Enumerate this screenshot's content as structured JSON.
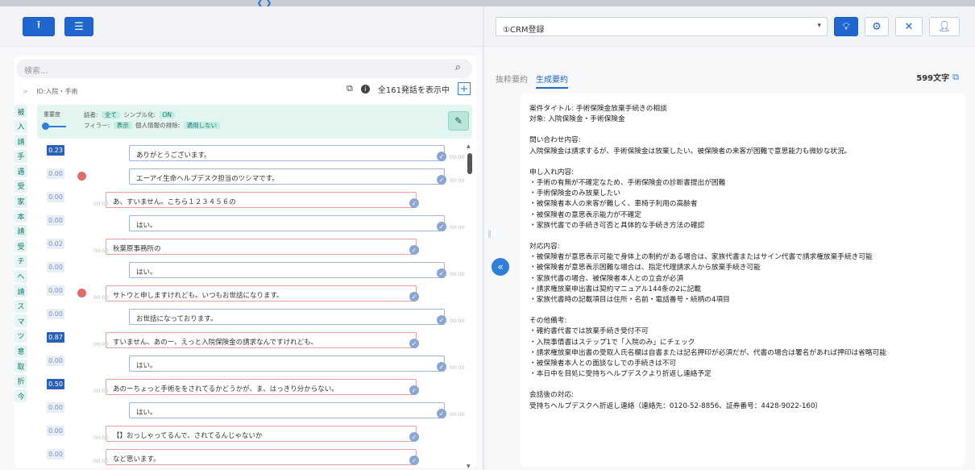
{
  "toolbar_left": {
    "upload_icon": "upload-icon",
    "list_icon": "list-icon"
  },
  "toolbar_right": {
    "select_value": "①CRM登録",
    "icons": [
      "bulb-icon",
      "gear-icon",
      "close-icon",
      "user-icon"
    ]
  },
  "search": {
    "placeholder": "検索..."
  },
  "transcript": {
    "breadcrumb": "ID:入院・手術",
    "count_text": "全161発話を表示中",
    "category_tags": [
      "被",
      "入",
      "請",
      "手",
      "遇",
      "受",
      "家",
      "本",
      "請",
      "受",
      "チ",
      "へ",
      "請",
      "ス",
      "マ",
      "ツ",
      "意",
      "取",
      "折",
      "今"
    ],
    "filter": {
      "importance_label": "重要度",
      "speaker_label": "話者:",
      "speaker_value": "全て",
      "simple_label": "シンプル化:",
      "simple_value": "ON",
      "filler_label": "フィラー:",
      "filler_value": "表示",
      "pii_label": "個人情報の排除:",
      "pii_value": "適用しない"
    },
    "rows": [
      {
        "score": "0.23",
        "speaker": "op",
        "text": "ありがとうございます。",
        "time": "00:00",
        "hot": true
      },
      {
        "score": "0.00",
        "speaker": "op",
        "text": "エーアイ生命ヘルプデスク担当のツシマです。",
        "time": "00:00",
        "avatar": true
      },
      {
        "score": "0.00",
        "speaker": "cu",
        "text": "あ、すいません。こちら１２３４５６の",
        "time": "00:00"
      },
      {
        "score": "0.00",
        "speaker": "op",
        "text": "はい。",
        "time": "00:00"
      },
      {
        "score": "0.02",
        "speaker": "cu",
        "text": "秋葉原事務所の",
        "time": "00:00"
      },
      {
        "score": "0.00",
        "speaker": "op",
        "text": "はい。",
        "time": "00:00"
      },
      {
        "score": "0.00",
        "speaker": "cu",
        "text": "サトウと申しますけれども。いつもお世話になります。",
        "time": "00:00",
        "avatar": true
      },
      {
        "score": "0.00",
        "speaker": "op",
        "text": "お世話になっております。",
        "time": "00:00"
      },
      {
        "score": "0.87",
        "speaker": "cu",
        "text": "すいません、あのー、えっと入院保険金の請求なんですけれども、",
        "time": "00:00",
        "hot": true
      },
      {
        "score": "0.00",
        "speaker": "op",
        "text": "はい。",
        "time": "00:00"
      },
      {
        "score": "0.50",
        "speaker": "cu",
        "text": "あのーちょっと手術ををされてるかどうかが、ま、はっきり分からない。",
        "time": "00:00",
        "hot": true
      },
      {
        "score": "0.00",
        "speaker": "op",
        "text": "はい。",
        "time": "00:00"
      },
      {
        "score": "0.00",
        "speaker": "cu",
        "text": "【】おっしゃってるんで、されてるんじゃないか",
        "time": "00:00"
      },
      {
        "score": "0.00",
        "speaker": "cu",
        "text": "など思います。",
        "time": "00:00"
      }
    ]
  },
  "summary_panel": {
    "tab_extract": "抜粋要約",
    "tab_generate": "生成要約",
    "char_count": "599文字",
    "lines": [
      "案件タイトル: 手術保険金放棄手続きの相談",
      "対象: 入院保険金・手術保険金",
      "",
      "問い合わせ内容:",
      "入院保険金は請求するが、手術保険金は放棄したい。被保険者の来客が困難で意思能力も微妙な状況。",
      "",
      "申し入れ内容:",
      "・手術の有無が不確定なため、手術保険金の診断書提出が困難",
      "・手術保険金のみ放棄したい",
      "・被保険者本人の来客が難しく、車椅子利用の高齢者",
      "・被保険者の意思表示能力が不確定",
      "・家族代書での手続き可否と具体的な手続き方法の確認",
      "",
      "対応内容:",
      "・被保険者が意思表示可能で身体上の制約がある場合は、家族代書またはサイン代書で請求権放棄手続き可能",
      "・被保険者が意思表示困難な場合は、指定代理請求人から放棄手続き可能",
      "・家族代書の場合、被保険者本人との立会が必須",
      "・請求権放棄申出書は契約マニュアル144条の2に記載",
      "・家族代書時の記載項目は住所・名前・電話番号・続柄の4項目",
      "",
      "その他備考:",
      "・確約書代書では放棄手続き受付不可",
      "・入院事情書はステップ1で「入院のみ」にチェック",
      "・請求権放棄申出書の受取人氏名欄は自書または記名押印が必須だが、代書の場合は署名があれば押印は省略可能",
      "・被保険者本人との面談なしでの手続きは不可",
      "・本日中を目処に受持ちヘルプデスクより折返し連絡予定",
      "",
      "会話後の対応:",
      "受持ちヘルプデスクへ折返し連絡（連絡先：0120-52-8856、証券番号：4428-9022-160）"
    ]
  },
  "colors": {
    "primary": "#1f66cf",
    "operator_border": "#9cb5de",
    "customer_border": "#ef9e9e",
    "filter_bg": "#e3f5f1"
  }
}
